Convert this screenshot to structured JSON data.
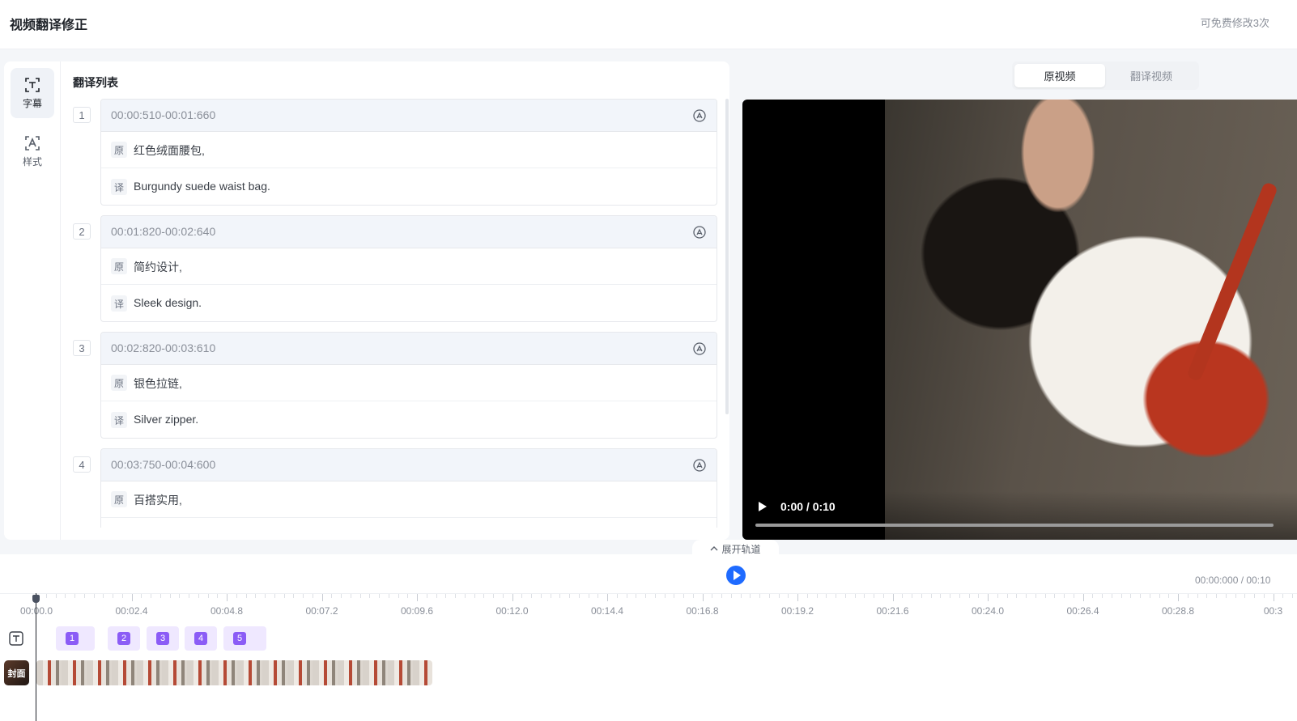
{
  "header": {
    "title": "视频翻译修正",
    "quota": "可免费修改3次"
  },
  "sidebar": {
    "items": [
      {
        "label": "字幕",
        "icon": "subtitle-icon"
      },
      {
        "label": "样式",
        "icon": "style-icon"
      }
    ]
  },
  "list": {
    "title": "翻译列表",
    "source_tag": "原",
    "target_tag": "译",
    "entries": [
      {
        "num": "1",
        "time": "00:00:510-00:01:660",
        "source": "红色绒面腰包,",
        "target": "Burgundy suede waist bag."
      },
      {
        "num": "2",
        "time": "00:01:820-00:02:640",
        "source": "简约设计,",
        "target": "Sleek design."
      },
      {
        "num": "3",
        "time": "00:02:820-00:03:610",
        "source": "银色拉链,",
        "target": "Silver zipper."
      },
      {
        "num": "4",
        "time": "00:03:750-00:04:600",
        "source": "百搭实用,",
        "target": ""
      }
    ]
  },
  "preview": {
    "tabs": [
      "原视频",
      "翻译视频"
    ],
    "active_tab": 0,
    "video_time": "0:00 / 0:10"
  },
  "timeline": {
    "expand_label": "展开轨道",
    "time_display": "00:00:000 / 00:10",
    "ticks": [
      "00:00.0",
      "00:02.4",
      "00:04.8",
      "00:07.2",
      "00:09.6",
      "00:12.0",
      "00:14.4",
      "00:16.8",
      "00:19.2",
      "00:21.6",
      "00:24.0",
      "00:26.4",
      "00:28.8",
      "00:3"
    ],
    "subtitle_chips": [
      "1",
      "2",
      "3",
      "4",
      "5"
    ],
    "cover_label": "封面",
    "accent_color": "#1f6bff",
    "chip_color": "#8b5cf6"
  }
}
